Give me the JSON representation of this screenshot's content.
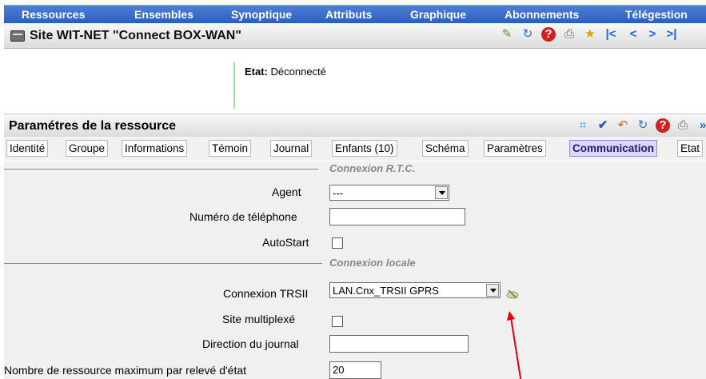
{
  "menu": [
    "Ressources",
    "Ensembles",
    "Synoptique",
    "Attributs",
    "Graphique",
    "Abonnements",
    "Télégestion"
  ],
  "site_title": "Site WIT-NET \"Connect BOX-WAN\"",
  "toolbar_icons": [
    "pencil-icon",
    "refresh-icon",
    "help-icon",
    "print-icon",
    "folder-icon",
    "first-icon",
    "prev-icon",
    "next-icon",
    "last-icon"
  ],
  "info": {
    "etat_label": "Etat:",
    "etat_value": "Déconnecté"
  },
  "section_title": "Paramétres de la ressource",
  "section_icons": [
    "edit-icon",
    "check-icon",
    "undo-icon",
    "refresh-icon",
    "help-icon",
    "print-icon",
    "more-icon"
  ],
  "tabs": [
    "Identité",
    "Groupe",
    "Informations",
    "Témoin",
    "Journal",
    "Enfants (10)",
    "Schéma",
    "Paramètres",
    "Communication",
    "Etat"
  ],
  "active_tab": "Communication",
  "rtc": {
    "legend": "Connexion R.T.C.",
    "agent_label": "Agent",
    "agent_value": "---",
    "phone_label": "Numéro de téléphone",
    "autostart_label": "AutoStart"
  },
  "local": {
    "legend": "Connexion locale",
    "trsii_label": "Connexion TRSII",
    "trsii_value": "LAN.Cnx_TRSII GPRS",
    "multiplex_label": "Site multiplexé",
    "journal_label": "Direction du journal",
    "max_label": "Nombre de ressource maximum par relevé d'état",
    "max_value": "20"
  },
  "colors": {
    "menu_bg": "#3a6fd0",
    "active_tab_bg": "#d9d8f7",
    "arrow": "#e00000"
  }
}
